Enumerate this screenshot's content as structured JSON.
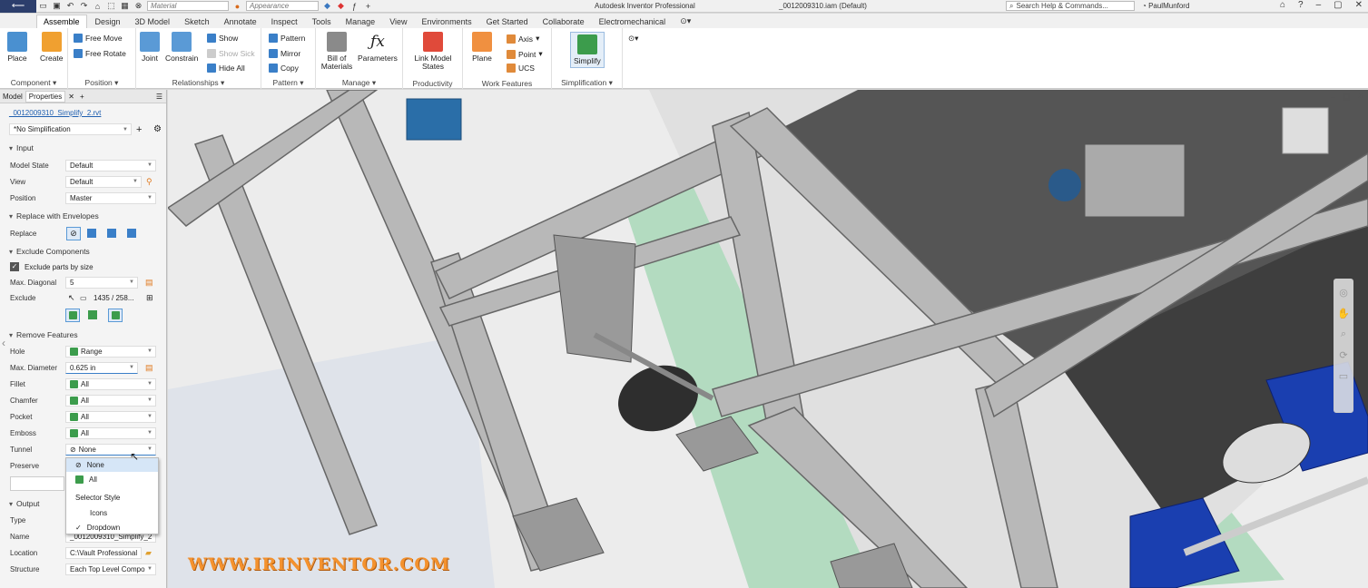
{
  "titlebar": {
    "file_label": "File",
    "material_placeholder": "Material",
    "appearance_placeholder": "Appearance",
    "app_title": "Autodesk Inventor Professional",
    "doc_title": "_0012009310.iam (Default)",
    "search_label": "Search Help & Commands...",
    "user_name": "PaulMunford"
  },
  "tabs": [
    "Assemble",
    "Design",
    "3D Model",
    "Sketch",
    "Annotate",
    "Inspect",
    "Tools",
    "Manage",
    "View",
    "Environments",
    "Get Started",
    "Collaborate",
    "Electromechanical"
  ],
  "ribbon": {
    "component": {
      "label": "Component",
      "place": "Place",
      "create": "Create"
    },
    "position": {
      "label": "Position",
      "free_move": "Free Move",
      "free_rotate": "Free Rotate"
    },
    "relationships": {
      "label": "Relationships",
      "joint": "Joint",
      "constrain": "Constrain",
      "show": "Show",
      "show_sick": "Show Sick",
      "hide_all": "Hide All"
    },
    "pattern": {
      "label": "Pattern",
      "pattern": "Pattern",
      "mirror": "Mirror",
      "copy": "Copy"
    },
    "manage": {
      "label": "Manage",
      "bom": "Bill of Materials",
      "parameters": "Parameters"
    },
    "productivity": {
      "label": "Productivity",
      "link_model_states": "Link Model States"
    },
    "work_features": {
      "label": "Work Features",
      "plane": "Plane",
      "axis": "Axis",
      "point": "Point",
      "ucs": "UCS"
    },
    "simplification": {
      "label": "Simplification",
      "simplify": "Simplify"
    }
  },
  "panel": {
    "tabs": [
      "Model",
      "Properties"
    ],
    "file_name": "_0012009310_Simplify_2.rvt",
    "simplification": "*No Simplification",
    "input": {
      "header": "Input",
      "model_state_label": "Model State",
      "model_state": "Default",
      "view_label": "View",
      "view": "Default",
      "position_label": "Position",
      "position": "Master"
    },
    "envelopes": {
      "header": "Replace with Envelopes",
      "replace_label": "Replace"
    },
    "exclude": {
      "header": "Exclude Components",
      "by_size": "Exclude parts by size",
      "max_diag_label": "Max. Diagonal",
      "max_diag": "5",
      "exclude_label": "Exclude",
      "exclude_count": "1435 / 258..."
    },
    "remove": {
      "header": "Remove Features",
      "hole_label": "Hole",
      "hole": "Range",
      "max_dia_label": "Max. Diameter",
      "max_dia": "0.625 in",
      "fillet_label": "Fillet",
      "fillet": "All",
      "chamfer_label": "Chamfer",
      "chamfer": "All",
      "pocket_label": "Pocket",
      "pocket": "All",
      "emboss_label": "Emboss",
      "emboss": "All",
      "tunnel_label": "Tunnel",
      "tunnel": "None",
      "preserve_label": "Preserve"
    },
    "output": {
      "header": "Output",
      "type_label": "Type",
      "name_label": "Name",
      "name": "_0012009310_Simplify_2",
      "location_label": "Location",
      "location": "C:\\Vault Professional",
      "structure_label": "Structure",
      "structure": "Each Top Level Compo"
    }
  },
  "dropdown": {
    "none": "None",
    "all": "All",
    "selector_style": "Selector Style",
    "icons": "Icons",
    "dropdown": "Dropdown"
  },
  "watermark": "WWW.IRINVENTOR.COM"
}
